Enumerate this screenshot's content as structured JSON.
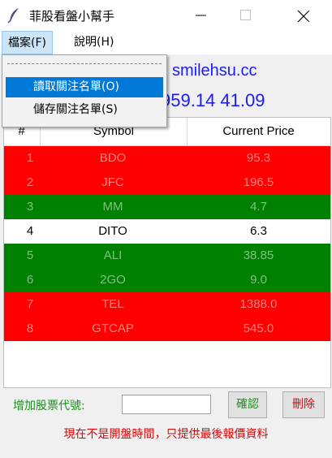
{
  "window": {
    "title": "菲股看盤小幫手",
    "icon": "feather-icon"
  },
  "menubar": {
    "file_label": "檔案(F)",
    "help_label": "說明(H)"
  },
  "file_menu": {
    "items": [
      {
        "label": "讀取關注名單(O)",
        "highlighted": true
      },
      {
        "label": "儲存關注名單(S)",
        "highlighted": false
      }
    ]
  },
  "info": {
    "line1": "smilehsu.cc",
    "line2": "959.14 41.09"
  },
  "table": {
    "headers": [
      "#",
      "Symbol",
      "Current Price"
    ],
    "rows": [
      {
        "num": "1",
        "symbol": "BDO",
        "price": "95.3",
        "color": "red"
      },
      {
        "num": "2",
        "symbol": "JFC",
        "price": "196.5",
        "color": "red"
      },
      {
        "num": "3",
        "symbol": "MM",
        "price": "4.7",
        "color": "green"
      },
      {
        "num": "4",
        "symbol": "DITO",
        "price": "6.3",
        "color": "white"
      },
      {
        "num": "5",
        "symbol": "ALI",
        "price": "38.85",
        "color": "green"
      },
      {
        "num": "6",
        "symbol": "2GO",
        "price": "9.0",
        "color": "green"
      },
      {
        "num": "7",
        "symbol": "TEL",
        "price": "1388.0",
        "color": "red"
      },
      {
        "num": "8",
        "symbol": "GTCAP",
        "price": "545.0",
        "color": "red"
      }
    ]
  },
  "colors": {
    "up_red": "#ff0000",
    "down_green": "#008000",
    "neutral_white": "#ffffff",
    "label_green": "#1e8c1e",
    "status_red": "#e60000",
    "link_blue": "#1a1aff"
  },
  "add_stock": {
    "label": "增加股票代號:",
    "input_value": "",
    "confirm_label": "確認",
    "delete_label": "刪除"
  },
  "status": {
    "message": "現在不是開盤時間，只提供最後報價資料"
  }
}
